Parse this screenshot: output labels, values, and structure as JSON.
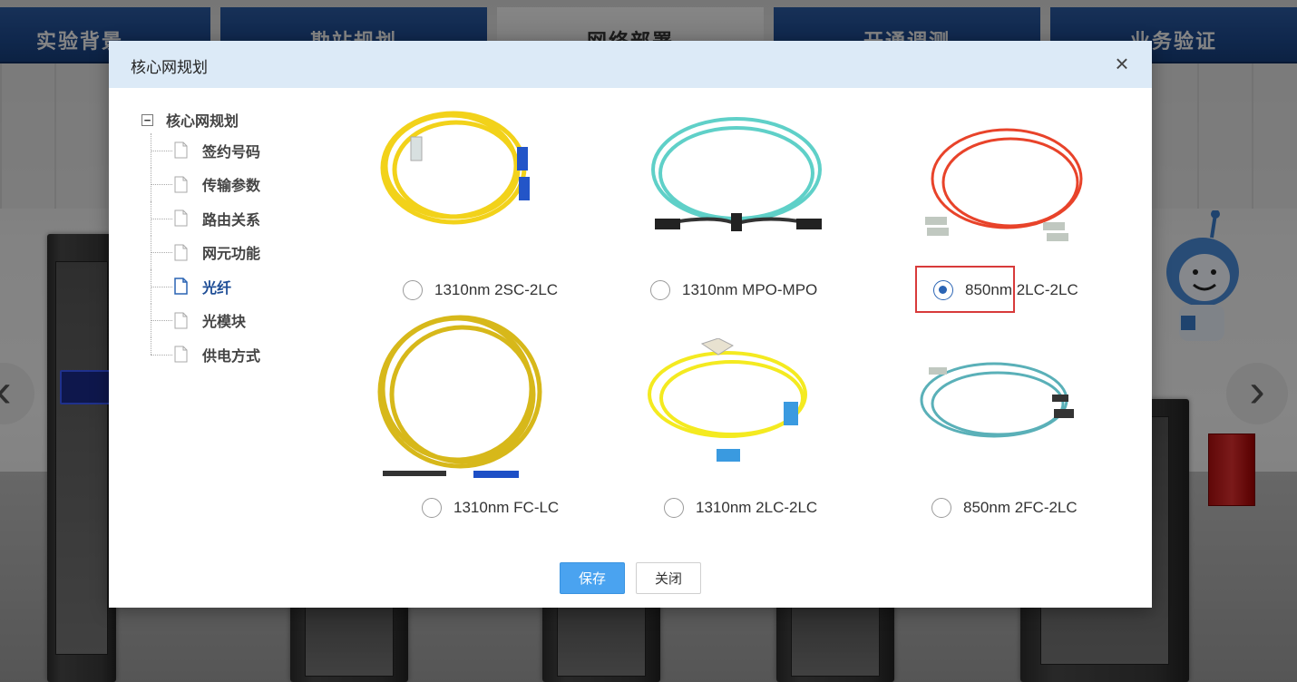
{
  "top_tabs": [
    {
      "label": "实验背景",
      "active": false
    },
    {
      "label": "勘站规划",
      "active": false
    },
    {
      "label": "网络部署",
      "active": true
    },
    {
      "label": "开通调测",
      "active": false
    },
    {
      "label": "业务验证",
      "active": false
    }
  ],
  "modal": {
    "title": "核心网规划",
    "close_icon": "close-icon"
  },
  "tree": {
    "root_label": "核心网规划",
    "toggle_symbol": "−",
    "items": [
      {
        "label": "签约号码",
        "selected": false
      },
      {
        "label": "传输参数",
        "selected": false
      },
      {
        "label": "路由关系",
        "selected": false
      },
      {
        "label": "网元功能",
        "selected": false
      },
      {
        "label": "光纤",
        "selected": true
      },
      {
        "label": "光模块",
        "selected": false
      },
      {
        "label": "供电方式",
        "selected": false
      }
    ]
  },
  "options": [
    {
      "label": "1310nm 2SC-2LC",
      "checked": false,
      "image": "yellow-fiber-sc-lc"
    },
    {
      "label": "1310nm MPO-MPO",
      "checked": false,
      "image": "aqua-fiber-mpo"
    },
    {
      "label": "850nm 2LC-2LC",
      "checked": true,
      "image": "orange-fiber-lc-lc"
    },
    {
      "label": "1310nm FC-LC",
      "checked": false,
      "image": "yellow-fiber-fc-lc"
    },
    {
      "label": "1310nm 2LC-2LC",
      "checked": false,
      "image": "yellow-fiber-lc-lc"
    },
    {
      "label": "850nm 2FC-2LC",
      "checked": false,
      "image": "aqua-fiber-fc-lc"
    }
  ],
  "buttons": {
    "save_label": "保存",
    "close_label": "关闭"
  },
  "colors": {
    "tab_blue": "#1e4a8e",
    "header_bg": "#dceaf7",
    "accent_blue": "#2a64b4",
    "save_button": "#4aa3f0",
    "highlight_red": "#d83a3a"
  },
  "nav_arrows": {
    "left": "‹",
    "right": "›"
  }
}
